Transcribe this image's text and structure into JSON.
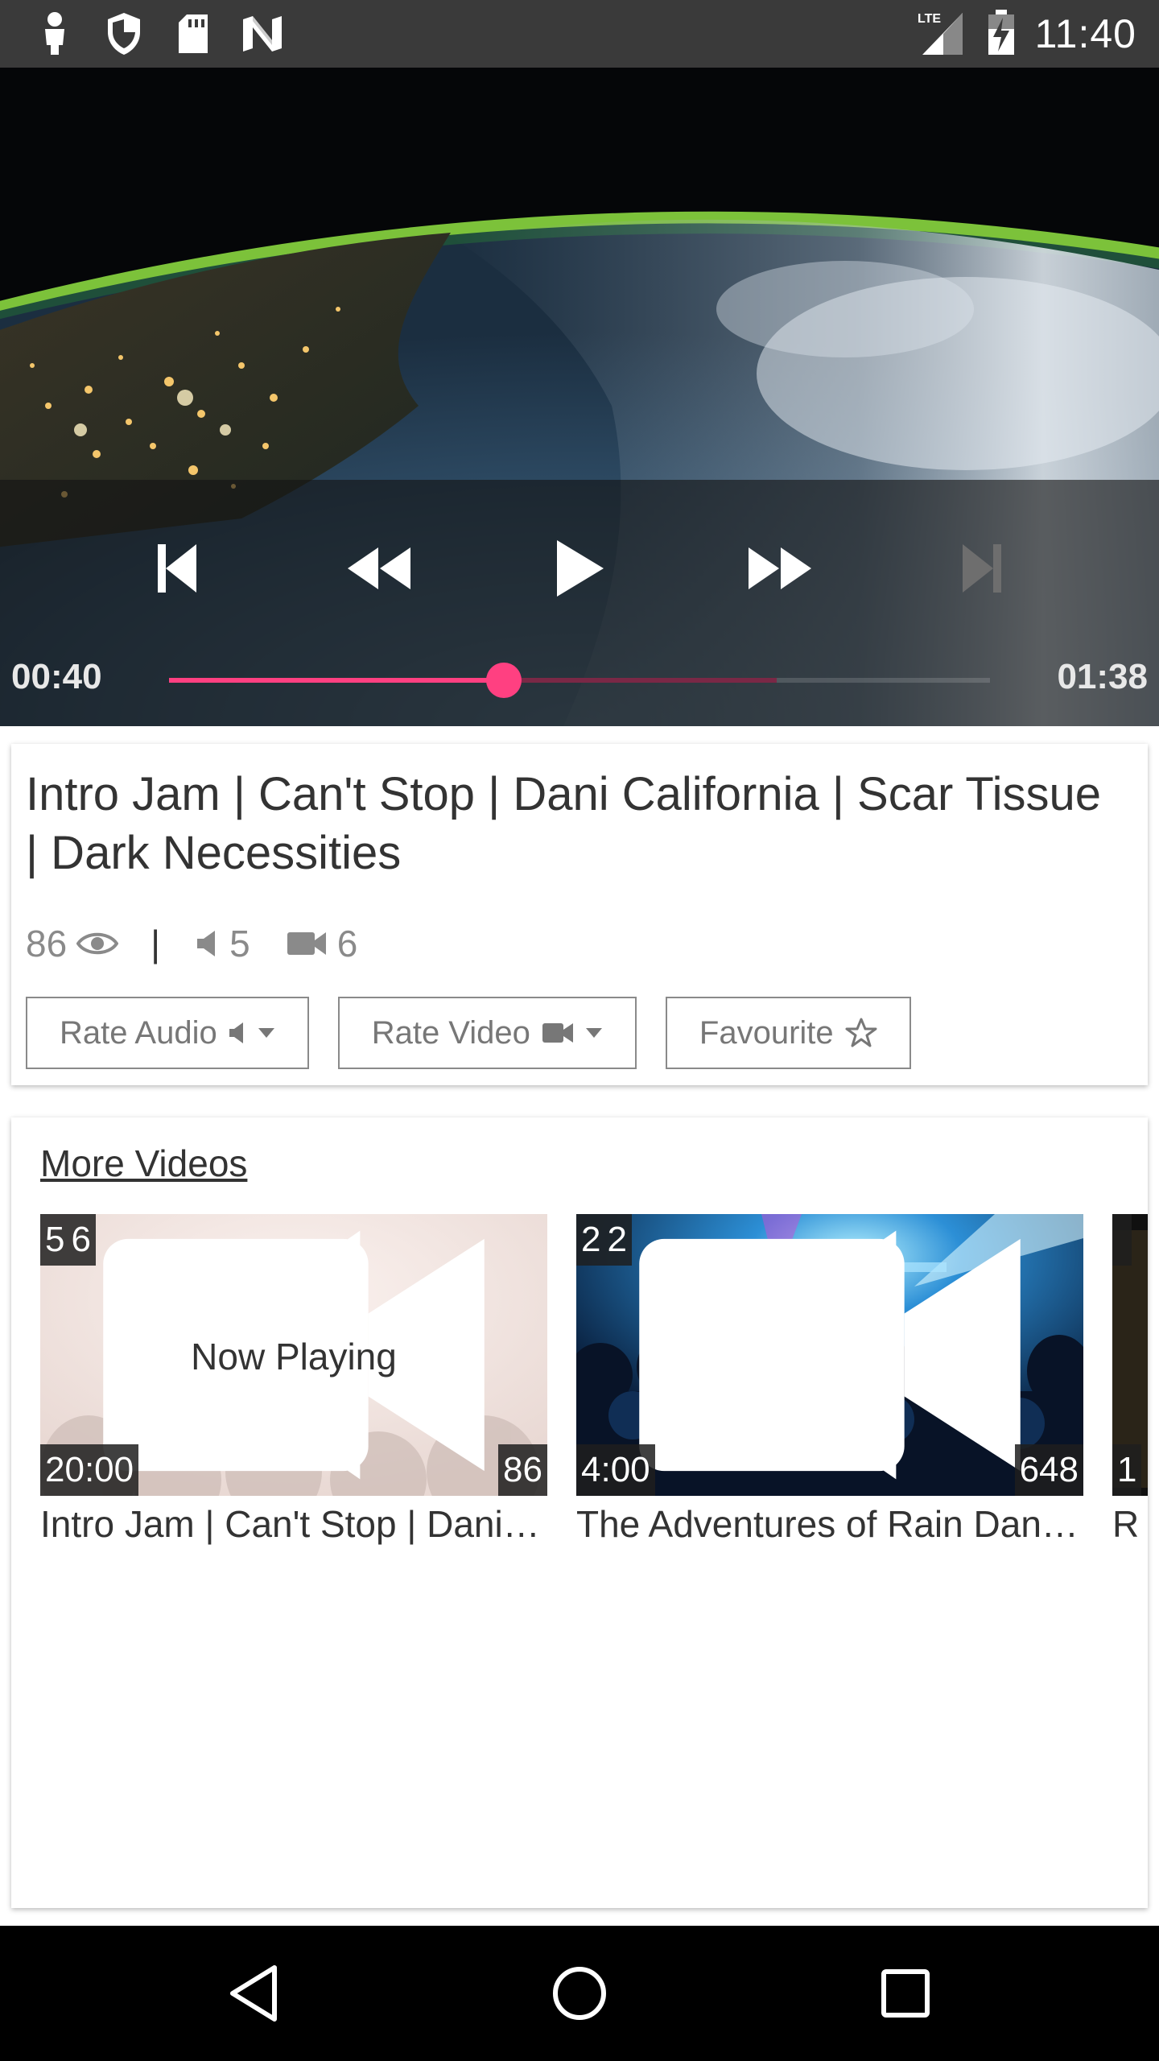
{
  "status_bar": {
    "time": "11:40",
    "network": "LTE",
    "icons": [
      "person-icon",
      "shield-icon",
      "sd-card-icon",
      "n-notification-icon",
      "signal-icon",
      "battery-charging-icon"
    ]
  },
  "player": {
    "current_time": "00:40",
    "total_time": "01:38",
    "progress": 0.408,
    "buffered": 0.74,
    "controls": [
      "skip-previous-icon",
      "rewind-icon",
      "play-icon",
      "fast-forward-icon",
      "skip-next-icon"
    ],
    "accent_color": "#ff4081"
  },
  "video": {
    "title": "Intro Jam | Can't Stop | Dani California | Scar Tissue | Dark Necessities",
    "views": "86",
    "audio_ratings": "5",
    "video_ratings": "6",
    "separator": "|",
    "buttons": {
      "rate_audio": "Rate Audio",
      "rate_video": "Rate Video",
      "favourite": "Favourite"
    }
  },
  "more_videos": {
    "heading": "More Videos",
    "items": [
      {
        "audio": "5",
        "video": "6",
        "overlay": "Now Playing",
        "duration": "20:00",
        "views": "86",
        "title": "Intro Jam | Can't Stop | Dani California"
      },
      {
        "audio": "2",
        "video": "2",
        "duration": "4:00",
        "views": "648",
        "title": "The Adventures of Rain Dance Maggie"
      },
      {
        "duration": "1",
        "title": "R"
      }
    ]
  },
  "nav_bar": {
    "buttons": [
      "back-icon",
      "home-icon",
      "recents-icon"
    ]
  }
}
